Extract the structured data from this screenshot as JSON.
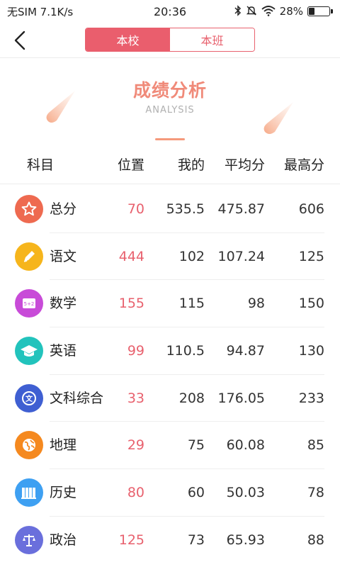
{
  "status_bar": {
    "carrier": "无SIM 7.1K/s",
    "time": "20:36",
    "battery": "28%",
    "battery_level": 0.28
  },
  "nav": {
    "tabs": [
      {
        "label": "本校",
        "active": true
      },
      {
        "label": "本班",
        "active": false
      }
    ]
  },
  "header": {
    "title": "成绩分析",
    "subtitle": "ANALYSIS"
  },
  "table": {
    "columns": [
      "科目",
      "位置",
      "我的",
      "平均分",
      "最高分"
    ],
    "rows": [
      {
        "subject": "总分",
        "icon": "star-icon",
        "color": "#ee6a50",
        "rank": "70",
        "mine": "535.5",
        "avg": "475.87",
        "max": "606"
      },
      {
        "subject": "语文",
        "icon": "pen-icon",
        "color": "#f6b51c",
        "rank": "444",
        "mine": "102",
        "avg": "107.24",
        "max": "125"
      },
      {
        "subject": "数学",
        "icon": "formula-icon",
        "color": "#c84bd8",
        "rank": "155",
        "mine": "115",
        "avg": "98",
        "max": "150"
      },
      {
        "subject": "英语",
        "icon": "graduation-cap-icon",
        "color": "#22c3bc",
        "rank": "99",
        "mine": "110.5",
        "avg": "94.87",
        "max": "130"
      },
      {
        "subject": "文科综合",
        "icon": "wen-icon",
        "color": "#3f5fd2",
        "rank": "33",
        "mine": "208",
        "avg": "176.05",
        "max": "233"
      },
      {
        "subject": "地理",
        "icon": "globe-icon",
        "color": "#f5891f",
        "rank": "29",
        "mine": "75",
        "avg": "60.08",
        "max": "85"
      },
      {
        "subject": "历史",
        "icon": "books-icon",
        "color": "#3ea0f2",
        "rank": "80",
        "mine": "60",
        "avg": "50.03",
        "max": "78"
      },
      {
        "subject": "政治",
        "icon": "scales-icon",
        "color": "#6a6fdc",
        "rank": "125",
        "mine": "73",
        "avg": "65.93",
        "max": "88"
      }
    ]
  }
}
